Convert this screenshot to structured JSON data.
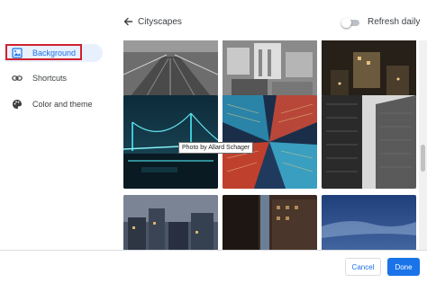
{
  "sidebar": {
    "items": [
      {
        "label": "Background",
        "icon": "image-icon",
        "active": true
      },
      {
        "label": "Shortcuts",
        "icon": "link-icon",
        "active": false
      },
      {
        "label": "Color and theme",
        "icon": "palette-icon",
        "active": false
      }
    ]
  },
  "header": {
    "back_icon": "arrow-left-icon",
    "title": "Cityscapes",
    "refresh_label": "Refresh daily",
    "refresh_enabled": false
  },
  "gallery": {
    "tooltip": "Photo by Allard Schager",
    "tiles": [
      "bridge-walkway-bw",
      "aerial-city-bw",
      "night-city-dark",
      "bay-bridge-night",
      "skyscrapers-looking-up",
      "tower-bw-closeup",
      "city-skyline-dusk",
      "tall-building-dark",
      "dusk-sky-blue"
    ]
  },
  "footer": {
    "cancel_label": "Cancel",
    "done_label": "Done"
  },
  "colors": {
    "accent": "#1a73e8",
    "active_bg": "#e8f0fe",
    "highlight_border": "#d0202f"
  }
}
